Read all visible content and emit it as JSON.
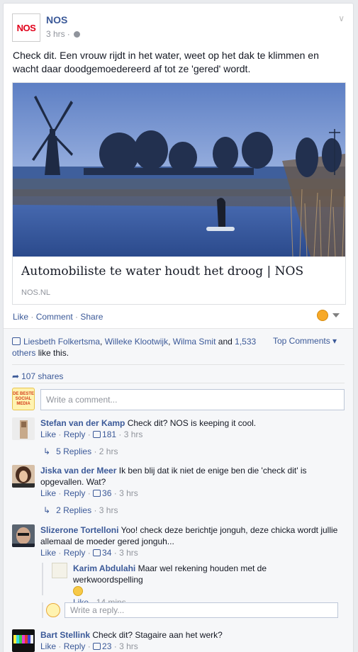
{
  "post": {
    "page_name": "NOS",
    "logo_text": "NOS",
    "time": "3 hrs",
    "dot": "·",
    "text": "Check dit. Een vrouw rijdt in het water, weet op het dak te klimmen en wacht daar doodgemoedereerd af tot ze 'gered' wordt.",
    "link_title": "Automobiliste te water houdt het droog | NOS",
    "link_domain": "NOS.NL"
  },
  "actions": {
    "like": "Like",
    "comment": "Comment",
    "share": "Share",
    "sep": " · "
  },
  "ufi": {
    "likers": [
      "Liesbeth Folkertsma",
      "Willeke Klootwijk",
      "Wilma Smit"
    ],
    "and_text": "and",
    "others_count": "1,533",
    "others_word": "others",
    "like_this": "like this.",
    "top_comments": "Top Comments",
    "shares": "107 shares",
    "write_comment_placeholder": "Write a comment...",
    "badge_text": "DE BESTE SOCIAL MEDIA"
  },
  "comments": [
    {
      "author": "Stefan van der Kamp",
      "text": "Check dit? NOS is keeping it cool.",
      "like": "Like",
      "reply": "Reply",
      "likes": "181",
      "time": "3 hrs",
      "replies_label": "5 Replies",
      "replies_time": "2 hrs"
    },
    {
      "author": "Jiska van der Meer",
      "text": "Ik ben blij dat ik niet de enige ben die 'check dit' is opgevallen. Wat?",
      "like": "Like",
      "reply": "Reply",
      "likes": "36",
      "time": "3 hrs",
      "replies_label": "2 Replies",
      "replies_time": "3 hrs"
    },
    {
      "author": "Slizerone Tortelloni",
      "text": "Yoo! check deze berichtje jonguh, deze chicka wordt jullie allemaal de moeder gered jonguh...",
      "like": "Like",
      "reply": "Reply",
      "likes": "34",
      "time": "3 hrs"
    },
    {
      "author": "Bart Stellink",
      "text": "Check dit? Stagaire aan het werk?",
      "like": "Like",
      "reply": "Reply",
      "likes": "23",
      "time": "3 hrs"
    }
  ],
  "reply": {
    "author": "Karim Abdulahi",
    "text": "Maar wel rekening houden met de werkwoordspelling",
    "like": "Like",
    "time": "14 mins",
    "write_reply_placeholder": "Write a reply..."
  },
  "colors": {
    "link": "#3b5998",
    "meta": "#90949c",
    "nos_red": "#e1001a",
    "badge_orange": "#f7a928"
  }
}
